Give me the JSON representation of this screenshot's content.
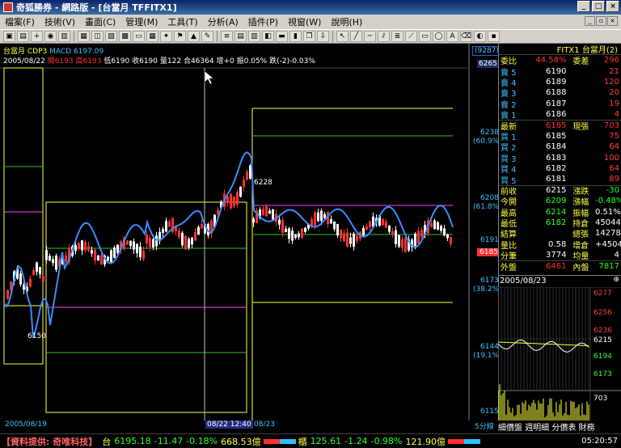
{
  "window": {
    "title": "奇狐勝券 - 網路版 - [台當月 TFFITX1]",
    "buttons": {
      "minimize": "_",
      "maximize": "□",
      "close": "×"
    }
  },
  "menu": {
    "items": [
      "檔案(F)",
      "技術(V)",
      "畫面(C)",
      "管理(M)",
      "工具(T)",
      "分析(A)",
      "插件(P)",
      "視窗(W)",
      "說明(H)"
    ]
  },
  "chart": {
    "header_line1": {
      "name": "台當月 CDP3",
      "indicator": "MACD 6197.09",
      "tag": "(9287)",
      "level": "6265"
    },
    "header_line2": {
      "date": "2005/08/22",
      "open": "開6193",
      "high": "高6193",
      "low": "低6190",
      "close": "收6190",
      "vol": "量122",
      "total": "合46364",
      "change": "增+0",
      "pct": "振0.05%",
      "extra": "跌(-2)-0.03%"
    },
    "price_axis": [
      {
        "value": "6238",
        "pct": "(60.9%)"
      },
      {
        "value": "6208",
        "pct": "(61.8%)"
      },
      {
        "value": "6191",
        "pct": ""
      },
      {
        "value": "6185",
        "pct": ""
      },
      {
        "value": "6173",
        "pct": "(38.2%)"
      },
      {
        "value": "6144",
        "pct": "(19.1%)"
      },
      {
        "value": "6115",
        "pct": ""
      }
    ],
    "annotations": {
      "peak": "6228",
      "trough": "6150"
    },
    "dates": {
      "left": "2005/08/19",
      "cursor": "08/22 12:40",
      "right": "08/23",
      "mode": "5分線"
    }
  },
  "quote": {
    "header": "FITX1 台當月(2)",
    "top": {
      "label1": "委比",
      "val1": "44.58%",
      "label2": "委差",
      "val2": "296"
    },
    "asks": [
      {
        "label": "賣 5",
        "price": "6190",
        "qty": "21"
      },
      {
        "label": "賣 4",
        "price": "6189",
        "qty": "120"
      },
      {
        "label": "賣 3",
        "price": "6188",
        "qty": "20"
      },
      {
        "label": "賣 2",
        "price": "6187",
        "qty": "19"
      },
      {
        "label": "賣 1",
        "price": "6186",
        "qty": "4"
      }
    ],
    "last": {
      "label": "最新",
      "price": "6185",
      "label2": "現張",
      "qty": "703"
    },
    "bids": [
      {
        "label": "買 1",
        "price": "6185",
        "qty": "75"
      },
      {
        "label": "買 2",
        "price": "6184",
        "qty": "64"
      },
      {
        "label": "買 3",
        "price": "6183",
        "qty": "100"
      },
      {
        "label": "買 4",
        "price": "6182",
        "qty": "64"
      },
      {
        "label": "買 5",
        "price": "6181",
        "qty": "89"
      }
    ],
    "stats": [
      {
        "l1": "前收",
        "v1": "6215",
        "l2": "漲跌",
        "v2": "-30"
      },
      {
        "l1": "今開",
        "v1": "6209",
        "l2": "漲幅",
        "v2": "-0.48%"
      },
      {
        "l1": "最高",
        "v1": "6214",
        "l2": "振幅",
        "v2": "0.51%"
      },
      {
        "l1": "最低",
        "v1": "6182",
        "l2": "持倉",
        "v2": "45044"
      },
      {
        "l1": "結算",
        "v1": "",
        "l2": "總張",
        "v2": "14278"
      },
      {
        "l1": "量比",
        "v1": "0.58",
        "l2": "增倉",
        "v2": "+45044"
      },
      {
        "l1": "分筆",
        "v1": "3774",
        "l2": "均量",
        "v2": "4"
      }
    ],
    "outer": {
      "l1": "外盤",
      "v1": "6461",
      "l2": "內盤",
      "v2": "7817"
    }
  },
  "mini": {
    "date": "2005/08/23",
    "prices": [
      "6277",
      "6256",
      "6236",
      "6215",
      "6194",
      "6173"
    ],
    "vol": "703",
    "footer": "細價盤 週明細 分價表 財務"
  },
  "status": {
    "source": "【資料提供: 奇唯科技】",
    "idx1_name": "台",
    "idx1_value": "6195.18",
    "idx1_change": "-11.47",
    "idx1_pct": "-0.18%",
    "idx1_vol": "668.53億",
    "idx2_name": "櫃",
    "idx2_value": "125.61",
    "idx2_change": "-1.24",
    "idx2_pct": "-0.98%",
    "idx2_vol": "121.90億",
    "clock": "05:20:57"
  },
  "colors": {
    "up": "#ff3030",
    "down": "#30ff30",
    "macd": "#3c8cff",
    "accent_yellow": "#ffff40"
  }
}
